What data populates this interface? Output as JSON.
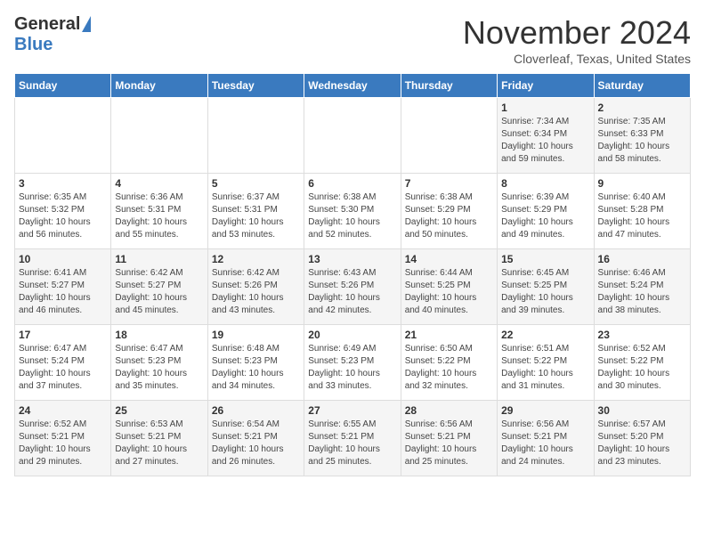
{
  "header": {
    "logo_general": "General",
    "logo_blue": "Blue",
    "month_title": "November 2024",
    "subtitle": "Cloverleaf, Texas, United States"
  },
  "days_of_week": [
    "Sunday",
    "Monday",
    "Tuesday",
    "Wednesday",
    "Thursday",
    "Friday",
    "Saturday"
  ],
  "weeks": [
    [
      {
        "day": "",
        "info": ""
      },
      {
        "day": "",
        "info": ""
      },
      {
        "day": "",
        "info": ""
      },
      {
        "day": "",
        "info": ""
      },
      {
        "day": "",
        "info": ""
      },
      {
        "day": "1",
        "info": "Sunrise: 7:34 AM\nSunset: 6:34 PM\nDaylight: 10 hours and 59 minutes."
      },
      {
        "day": "2",
        "info": "Sunrise: 7:35 AM\nSunset: 6:33 PM\nDaylight: 10 hours and 58 minutes."
      }
    ],
    [
      {
        "day": "3",
        "info": "Sunrise: 6:35 AM\nSunset: 5:32 PM\nDaylight: 10 hours and 56 minutes."
      },
      {
        "day": "4",
        "info": "Sunrise: 6:36 AM\nSunset: 5:31 PM\nDaylight: 10 hours and 55 minutes."
      },
      {
        "day": "5",
        "info": "Sunrise: 6:37 AM\nSunset: 5:31 PM\nDaylight: 10 hours and 53 minutes."
      },
      {
        "day": "6",
        "info": "Sunrise: 6:38 AM\nSunset: 5:30 PM\nDaylight: 10 hours and 52 minutes."
      },
      {
        "day": "7",
        "info": "Sunrise: 6:38 AM\nSunset: 5:29 PM\nDaylight: 10 hours and 50 minutes."
      },
      {
        "day": "8",
        "info": "Sunrise: 6:39 AM\nSunset: 5:29 PM\nDaylight: 10 hours and 49 minutes."
      },
      {
        "day": "9",
        "info": "Sunrise: 6:40 AM\nSunset: 5:28 PM\nDaylight: 10 hours and 47 minutes."
      }
    ],
    [
      {
        "day": "10",
        "info": "Sunrise: 6:41 AM\nSunset: 5:27 PM\nDaylight: 10 hours and 46 minutes."
      },
      {
        "day": "11",
        "info": "Sunrise: 6:42 AM\nSunset: 5:27 PM\nDaylight: 10 hours and 45 minutes."
      },
      {
        "day": "12",
        "info": "Sunrise: 6:42 AM\nSunset: 5:26 PM\nDaylight: 10 hours and 43 minutes."
      },
      {
        "day": "13",
        "info": "Sunrise: 6:43 AM\nSunset: 5:26 PM\nDaylight: 10 hours and 42 minutes."
      },
      {
        "day": "14",
        "info": "Sunrise: 6:44 AM\nSunset: 5:25 PM\nDaylight: 10 hours and 40 minutes."
      },
      {
        "day": "15",
        "info": "Sunrise: 6:45 AM\nSunset: 5:25 PM\nDaylight: 10 hours and 39 minutes."
      },
      {
        "day": "16",
        "info": "Sunrise: 6:46 AM\nSunset: 5:24 PM\nDaylight: 10 hours and 38 minutes."
      }
    ],
    [
      {
        "day": "17",
        "info": "Sunrise: 6:47 AM\nSunset: 5:24 PM\nDaylight: 10 hours and 37 minutes."
      },
      {
        "day": "18",
        "info": "Sunrise: 6:47 AM\nSunset: 5:23 PM\nDaylight: 10 hours and 35 minutes."
      },
      {
        "day": "19",
        "info": "Sunrise: 6:48 AM\nSunset: 5:23 PM\nDaylight: 10 hours and 34 minutes."
      },
      {
        "day": "20",
        "info": "Sunrise: 6:49 AM\nSunset: 5:23 PM\nDaylight: 10 hours and 33 minutes."
      },
      {
        "day": "21",
        "info": "Sunrise: 6:50 AM\nSunset: 5:22 PM\nDaylight: 10 hours and 32 minutes."
      },
      {
        "day": "22",
        "info": "Sunrise: 6:51 AM\nSunset: 5:22 PM\nDaylight: 10 hours and 31 minutes."
      },
      {
        "day": "23",
        "info": "Sunrise: 6:52 AM\nSunset: 5:22 PM\nDaylight: 10 hours and 30 minutes."
      }
    ],
    [
      {
        "day": "24",
        "info": "Sunrise: 6:52 AM\nSunset: 5:21 PM\nDaylight: 10 hours and 29 minutes."
      },
      {
        "day": "25",
        "info": "Sunrise: 6:53 AM\nSunset: 5:21 PM\nDaylight: 10 hours and 27 minutes."
      },
      {
        "day": "26",
        "info": "Sunrise: 6:54 AM\nSunset: 5:21 PM\nDaylight: 10 hours and 26 minutes."
      },
      {
        "day": "27",
        "info": "Sunrise: 6:55 AM\nSunset: 5:21 PM\nDaylight: 10 hours and 25 minutes."
      },
      {
        "day": "28",
        "info": "Sunrise: 6:56 AM\nSunset: 5:21 PM\nDaylight: 10 hours and 25 minutes."
      },
      {
        "day": "29",
        "info": "Sunrise: 6:56 AM\nSunset: 5:21 PM\nDaylight: 10 hours and 24 minutes."
      },
      {
        "day": "30",
        "info": "Sunrise: 6:57 AM\nSunset: 5:20 PM\nDaylight: 10 hours and 23 minutes."
      }
    ]
  ]
}
